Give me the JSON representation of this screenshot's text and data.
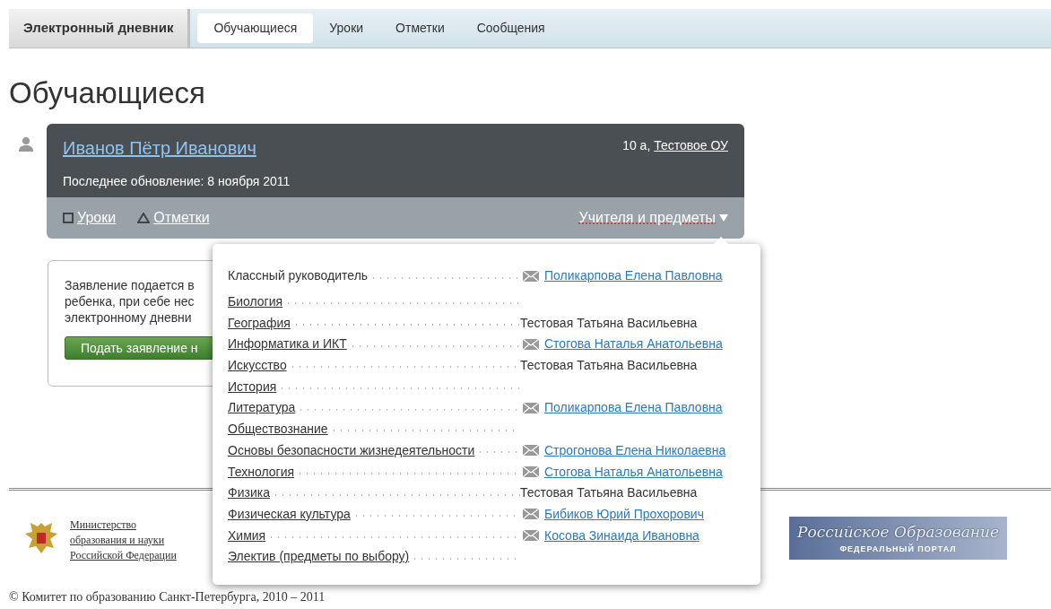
{
  "navbar": {
    "brand": "Электронный дневник",
    "tabs": [
      {
        "label": "Обучающиеся",
        "selected": true
      },
      {
        "label": "Уроки",
        "selected": false
      },
      {
        "label": "Отметки",
        "selected": false
      },
      {
        "label": "Сообщения",
        "selected": false
      }
    ]
  },
  "page_title": "Обучающиеся",
  "student": {
    "name": "Иванов Пётр Иванович",
    "class": "10 а,",
    "school": "Тестовое ОУ",
    "updated": "Последнее обновление: 8 ноября 2011",
    "links": [
      {
        "kind": "lessons",
        "label": "Уроки"
      },
      {
        "kind": "marks",
        "label": "Отметки"
      }
    ],
    "teachers_toggle": {
      "label": "Учителя и предметы",
      "expanded": true
    }
  },
  "teachers_popup": {
    "rows": [
      {
        "subject": "Классный руководитель",
        "subject_link": false,
        "teacher": "Поликарпова Елена Павловна",
        "kind": "mail"
      },
      {
        "subject": "Биология",
        "subject_link": true,
        "kind": "none"
      },
      {
        "subject": "География",
        "subject_link": true,
        "teacher": "Тестовая Татьяна Васильевна",
        "kind": "text"
      },
      {
        "subject": "Информатика и ИКТ",
        "subject_link": true,
        "teacher": "Стогова Наталья Анатольевна",
        "kind": "mail"
      },
      {
        "subject": "Искусство",
        "subject_link": true,
        "teacher": "Тестовая Татьяна Васильевна",
        "kind": "text"
      },
      {
        "subject": "История",
        "subject_link": true,
        "kind": "none"
      },
      {
        "subject": "Литература",
        "subject_link": true,
        "teacher": "Поликарпова Елена Павловна",
        "kind": "mail"
      },
      {
        "subject": "Обществознание",
        "subject_link": true,
        "kind": "none"
      },
      {
        "subject": "Основы безопасности жизнедеятельности",
        "subject_link": true,
        "teacher": "Строгонова Елена Николаевна",
        "kind": "mail"
      },
      {
        "subject": "Технология",
        "subject_link": true,
        "teacher": "Стогова Наталья Анатольевна",
        "kind": "mail"
      },
      {
        "subject": "Физика",
        "subject_link": true,
        "teacher": "Тестовая Татьяна Васильевна",
        "kind": "text"
      },
      {
        "subject": "Физическая культура",
        "subject_link": true,
        "teacher": "Бибиков Юрий Прохорович",
        "kind": "mail"
      },
      {
        "subject": "Химия",
        "subject_link": true,
        "teacher": "Косова Зинаида Ивановна",
        "kind": "mail"
      },
      {
        "subject": "Электив (предметы по выбору)",
        "subject_link": true,
        "kind": "none"
      }
    ]
  },
  "application_box": {
    "lines": [
      "Заявление подается в",
      "ребенка, при себе нес",
      "электронному дневни"
    ],
    "button": "Подать заявление н"
  },
  "footer": {
    "ministry": [
      "Министерство",
      "образования и науки",
      "Российской Федерации"
    ],
    "banner": {
      "title": "Российское Образование",
      "subtitle": "ФЕДЕРАЛЬНЫЙ ПОРТАЛ"
    },
    "copyright": "© Комитет по образованию Санкт-Петербурга, 2010 – 2011"
  }
}
